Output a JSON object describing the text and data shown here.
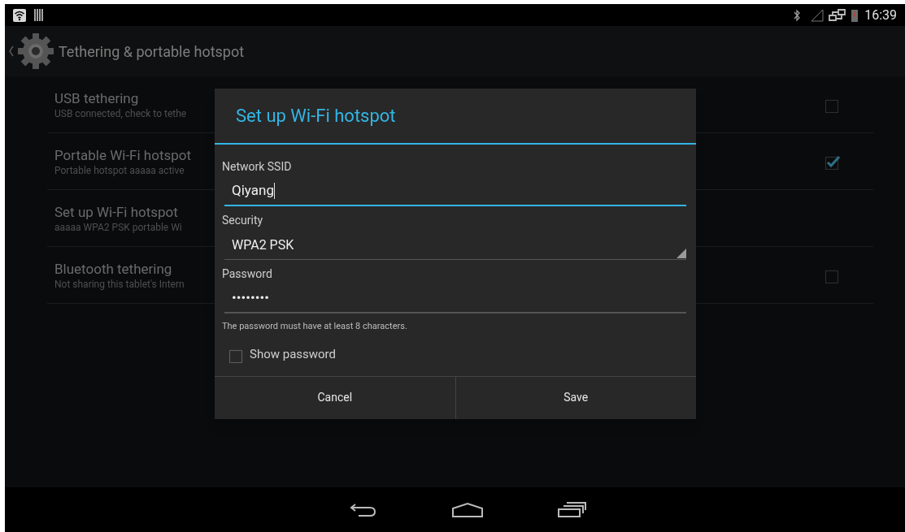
{
  "status_bar": {
    "time": "16:39"
  },
  "action_bar": {
    "title": "Tethering & portable hotspot"
  },
  "settings": [
    {
      "kind": "checkbox",
      "title": "USB tethering",
      "summary": "USB connected, check to tethe",
      "checked": false
    },
    {
      "kind": "checkbox",
      "title": "Portable Wi-Fi hotspot",
      "summary": "Portable hotspot aaaaa active",
      "checked": true
    },
    {
      "kind": "plain",
      "title": "Set up Wi-Fi hotspot",
      "summary": "aaaaa WPA2 PSK portable Wi"
    },
    {
      "kind": "checkbox",
      "title": "Bluetooth tethering",
      "summary": "Not sharing this tablet's Intern",
      "checked": false
    }
  ],
  "dialog": {
    "title": "Set up Wi-Fi hotspot",
    "fields": [
      {
        "kind": "text",
        "label": "Network SSID",
        "value": "Qiyang",
        "focused": true
      },
      {
        "kind": "dropdown",
        "label": "Security",
        "value": "WPA2 PSK",
        "focused": false
      },
      {
        "kind": "text",
        "label": "Password",
        "value": "••••••••",
        "focused": false
      }
    ],
    "hint": "The password must have at least 8 characters.",
    "show_password": {
      "label": "Show password",
      "checked": false
    },
    "buttons": [
      "Cancel",
      "Save"
    ]
  }
}
